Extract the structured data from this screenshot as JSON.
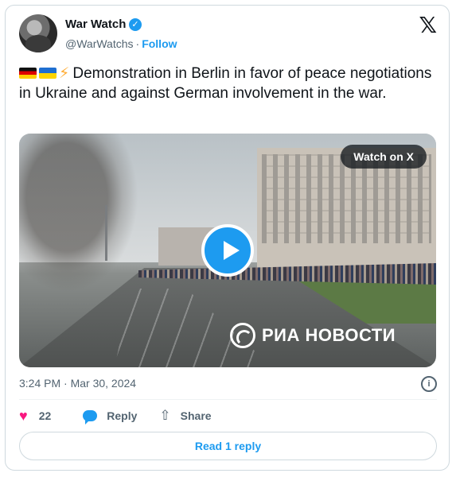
{
  "header": {
    "name": "War Watch",
    "handle": "@WarWatchs",
    "separator": "·",
    "follow_label": "Follow",
    "verified_icon": "verified-badge-icon",
    "brand_icon": "x-logo-icon"
  },
  "tweet": {
    "text": "Demonstration in Berlin in favor of peace negotiations in Ukraine and against German involvement in the war.",
    "emojis": [
      "germany-flag",
      "ukraine-flag",
      "high-voltage"
    ]
  },
  "video": {
    "watch_label": "Watch on X",
    "watermark": "РИА НОВОСТИ"
  },
  "meta": {
    "timestamp": "3:24 PM · Mar 30, 2024"
  },
  "actions": {
    "like_count": "22",
    "reply_label": "Reply",
    "share_label": "Share"
  },
  "footer": {
    "read_replies_label": "Read 1 reply"
  },
  "colors": {
    "accent": "#1d9bf0",
    "like": "#f91880",
    "muted": "#536471",
    "text": "#0f1419",
    "border": "#cfd9de"
  }
}
